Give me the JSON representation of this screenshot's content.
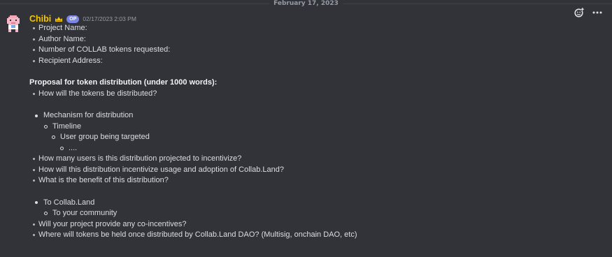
{
  "divider": {
    "date": "February 17, 2023"
  },
  "message": {
    "author": "Chibi",
    "badge": "OP",
    "timestamp": "02/17/2023 2:03 PM",
    "fields": [
      "Project Name:",
      "Author Name:",
      "Number of COLLAB tokens requested:",
      "Recipient Address:"
    ],
    "proposal_heading": "Proposal for token distribution (under 1000 words):",
    "q1": "How will the tokens be distributed?",
    "mechanism": "Mechanism for distribution",
    "timeline": "Timeline",
    "user_group": "User group being targeted",
    "ellipsis": "....",
    "questions": [
      "How many users is this distribution projected to incentivize?",
      "How will this distribution incentivize usage and adoption of Collab.Land?",
      "What is the benefit of this distribution?"
    ],
    "to_collab": "To Collab.Land",
    "to_community": "To your community",
    "q_coincentives": "Will your project provide any co-incentives?",
    "q_held": "Where will tokens be held once distributed by Collab.Land DAO? (Multisig, onchain DAO, etc)"
  },
  "colors": {
    "background": "#313338",
    "username": "#f5c400",
    "op_badge": "#7a85e8",
    "text": "#dbdee1",
    "muted": "#949ba4"
  },
  "icons": {
    "reaction": "add-reaction-icon",
    "more": "more-options-icon",
    "avatar": "pixel-avatar",
    "crown": "crown-icon"
  }
}
